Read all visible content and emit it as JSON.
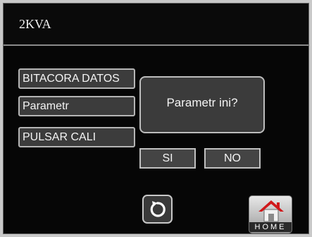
{
  "header": {
    "title": "2KVA"
  },
  "menu": {
    "items": [
      {
        "label": "BITACORA DATOS"
      },
      {
        "label": "Parametr"
      },
      {
        "label": "PULSAR CALI"
      }
    ]
  },
  "dialog": {
    "message": "Parametr ini?",
    "yes_label": "SI",
    "no_label": "NO"
  },
  "footer": {
    "refresh_icon": "refresh-icon",
    "home_icon": "home-icon",
    "home_label": "HOME"
  },
  "colors": {
    "background": "#060606",
    "button_fill": "#3c3c3c",
    "button_border": "#b5b5b5",
    "text": "#f4f4f4",
    "home_roof": "#d0191b"
  }
}
